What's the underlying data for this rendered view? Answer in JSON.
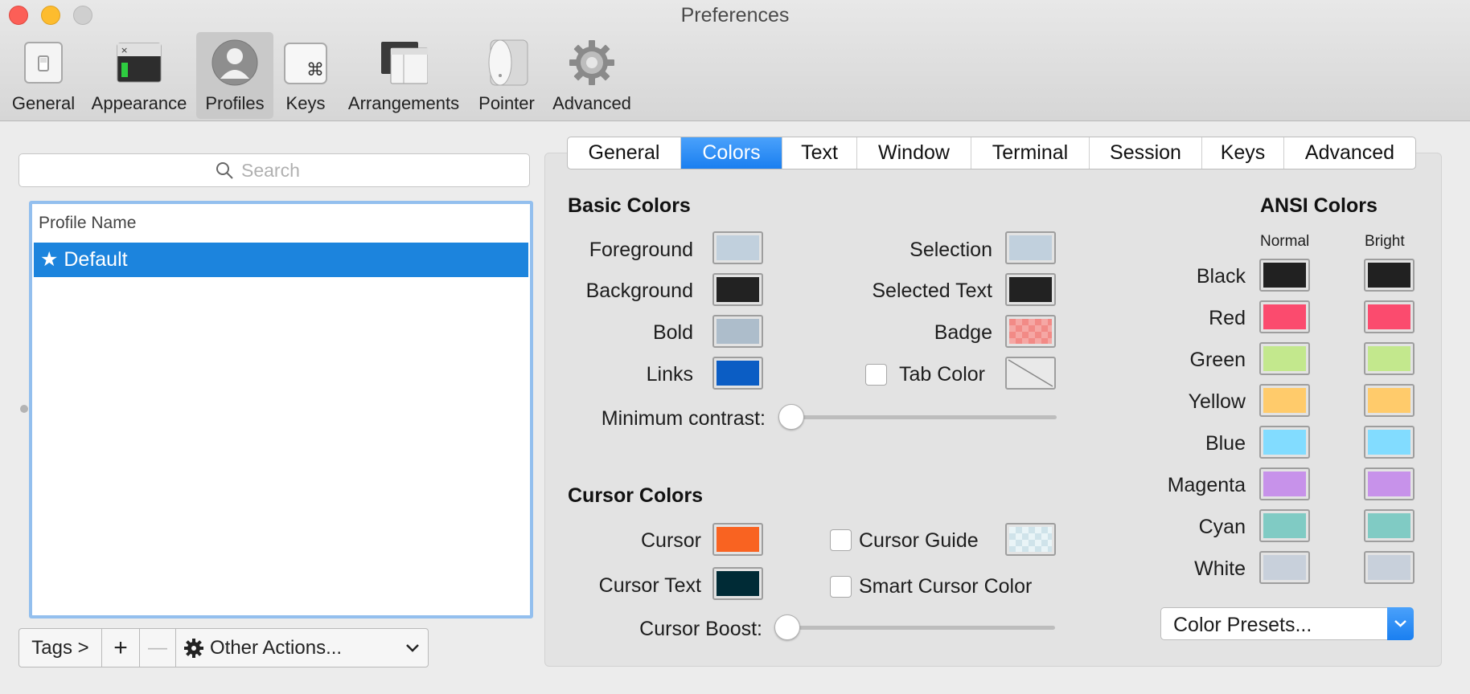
{
  "window": {
    "title": "Preferences"
  },
  "toolbar": {
    "items": [
      {
        "label": "General",
        "icon": "switch-icon"
      },
      {
        "label": "Appearance",
        "icon": "window-appearance-icon"
      },
      {
        "label": "Profiles",
        "icon": "person-icon"
      },
      {
        "label": "Keys",
        "icon": "command-key-icon"
      },
      {
        "label": "Arrangements",
        "icon": "windows-arrangement-icon"
      },
      {
        "label": "Pointer",
        "icon": "mouse-icon"
      },
      {
        "label": "Advanced",
        "icon": "gear-icon"
      }
    ],
    "active": "Profiles"
  },
  "sidebar": {
    "search": {
      "placeholder": "Search",
      "value": ""
    },
    "column_header": "Profile Name",
    "profiles": [
      {
        "name": "★ Default",
        "selected": true
      }
    ],
    "tags_button": "Tags >",
    "add_button": "+",
    "remove_button": "—",
    "other_actions": "Other Actions..."
  },
  "tabs": {
    "items": [
      "General",
      "Colors",
      "Text",
      "Window",
      "Terminal",
      "Session",
      "Keys",
      "Advanced"
    ],
    "active": "Colors"
  },
  "basic_colors": {
    "title": "Basic Colors",
    "foreground": {
      "label": "Foreground",
      "color": "#c1d0dd"
    },
    "background": {
      "label": "Background",
      "color": "#222222"
    },
    "bold": {
      "label": "Bold",
      "color": "#adbdcb"
    },
    "links": {
      "label": "Links",
      "color": "#0b5dc4"
    },
    "selection": {
      "label": "Selection",
      "color": "#c1d0dd"
    },
    "selected_text": {
      "label": "Selected Text",
      "color": "#222222"
    },
    "badge": {
      "label": "Badge",
      "color": "#f28a86"
    },
    "tab_color": {
      "label": "Tab Color",
      "checked": false
    },
    "minimum_contrast": {
      "label": "Minimum contrast:",
      "value": 0
    }
  },
  "cursor_colors": {
    "title": "Cursor Colors",
    "cursor": {
      "label": "Cursor",
      "color": "#f96321"
    },
    "cursor_text": {
      "label": "Cursor Text",
      "color": "#002b36"
    },
    "cursor_guide": {
      "label": "Cursor Guide",
      "checked": false
    },
    "smart_cursor": {
      "label": "Smart Cursor Color",
      "checked": false
    },
    "cursor_boost": {
      "label": "Cursor Boost:",
      "value": 0
    }
  },
  "ansi": {
    "title": "ANSI Colors",
    "normal_header": "Normal",
    "bright_header": "Bright",
    "rows": [
      {
        "name": "Black",
        "normal": "#212121",
        "bright": "#212121"
      },
      {
        "name": "Red",
        "normal": "#fb4b6e",
        "bright": "#fb4b6e"
      },
      {
        "name": "Green",
        "normal": "#c3e88d",
        "bright": "#c3e88d"
      },
      {
        "name": "Yellow",
        "normal": "#ffcb6b",
        "bright": "#ffcb6b"
      },
      {
        "name": "Blue",
        "normal": "#82dcff",
        "bright": "#82dcff"
      },
      {
        "name": "Magenta",
        "normal": "#c792ea",
        "bright": "#c792ea"
      },
      {
        "name": "Cyan",
        "normal": "#80cbc4",
        "bright": "#80cbc4"
      },
      {
        "name": "White",
        "normal": "#c8d0db",
        "bright": "#c8d0db"
      }
    ],
    "presets": "Color Presets..."
  }
}
